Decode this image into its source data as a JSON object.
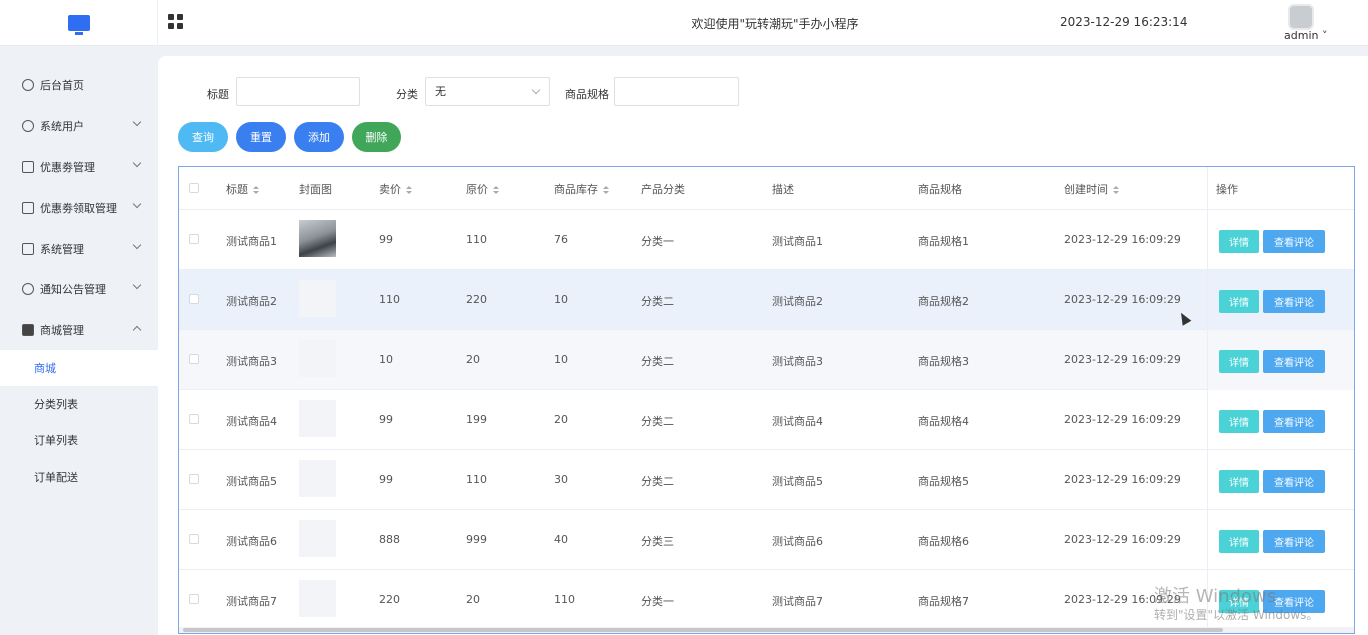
{
  "header": {
    "welcome": "欢迎使用\"玩转潮玩\"手办小程序",
    "datetime": "2023-12-29 16:23:14",
    "user": "admin ˅"
  },
  "sidebar": {
    "items": [
      {
        "label": "后台首页",
        "icon": "clock-icon"
      },
      {
        "label": "系统用户",
        "icon": "user-icon"
      },
      {
        "label": "优惠劵管理",
        "icon": "coupon-icon"
      },
      {
        "label": "优惠劵领取管理",
        "icon": "coupon-icon"
      },
      {
        "label": "系统管理",
        "icon": "folder-icon"
      },
      {
        "label": "通知公告管理",
        "icon": "sun-icon"
      },
      {
        "label": "商城管理",
        "icon": "store-icon"
      }
    ],
    "sub_items": [
      {
        "label": "商城",
        "active": true
      },
      {
        "label": "分类列表"
      },
      {
        "label": "订单列表"
      },
      {
        "label": "订单配送"
      }
    ]
  },
  "filters": {
    "title_label": "标题",
    "title_value": "",
    "category_label": "分类",
    "category_value": "无",
    "spec_label": "商品规格",
    "spec_value": ""
  },
  "buttons": {
    "query": "查询",
    "reset": "重置",
    "add": "添加",
    "delete": "删除"
  },
  "colors": {
    "query": "#4fb9f4",
    "reset": "#3a7ff0",
    "add": "#3a7ff0",
    "delete": "#3fa65a"
  },
  "table": {
    "columns": [
      "标题",
      "封面图",
      "卖价",
      "原价",
      "商品库存",
      "产品分类",
      "描述",
      "商品规格",
      "创建时间",
      "操作"
    ],
    "rows": [
      {
        "title": "测试商品1",
        "has_photo": true,
        "price": "99",
        "orig": "110",
        "stock": "76",
        "category": "分类一",
        "desc": "测试商品1",
        "spec": "商品规格1",
        "created": "2023-12-29 16:09:29"
      },
      {
        "title": "测试商品2",
        "has_photo": false,
        "price": "110",
        "orig": "220",
        "stock": "10",
        "category": "分类二",
        "desc": "测试商品2",
        "spec": "商品规格2",
        "created": "2023-12-29 16:09:29"
      },
      {
        "title": "测试商品3",
        "has_photo": false,
        "price": "10",
        "orig": "20",
        "stock": "10",
        "category": "分类二",
        "desc": "测试商品3",
        "spec": "商品规格3",
        "created": "2023-12-29 16:09:29"
      },
      {
        "title": "测试商品4",
        "has_photo": false,
        "price": "99",
        "orig": "199",
        "stock": "20",
        "category": "分类二",
        "desc": "测试商品4",
        "spec": "商品规格4",
        "created": "2023-12-29 16:09:29"
      },
      {
        "title": "测试商品5",
        "has_photo": false,
        "price": "99",
        "orig": "110",
        "stock": "30",
        "category": "分类二",
        "desc": "测试商品5",
        "spec": "商品规格5",
        "created": "2023-12-29 16:09:29"
      },
      {
        "title": "测试商品6",
        "has_photo": false,
        "price": "888",
        "orig": "999",
        "stock": "40",
        "category": "分类三",
        "desc": "测试商品6",
        "spec": "商品规格6",
        "created": "2023-12-29 16:09:29"
      },
      {
        "title": "测试商品7",
        "has_photo": false,
        "price": "220",
        "orig": "20",
        "stock": "110",
        "category": "分类一",
        "desc": "测试商品7",
        "spec": "商品规格7",
        "created": "2023-12-29 16:09:29"
      }
    ],
    "detail_label": "详情",
    "comment_label": "查看评论"
  },
  "watermark": {
    "line1": "激活 Windows",
    "line2": "转到\"设置\"以激活 Windows。"
  }
}
